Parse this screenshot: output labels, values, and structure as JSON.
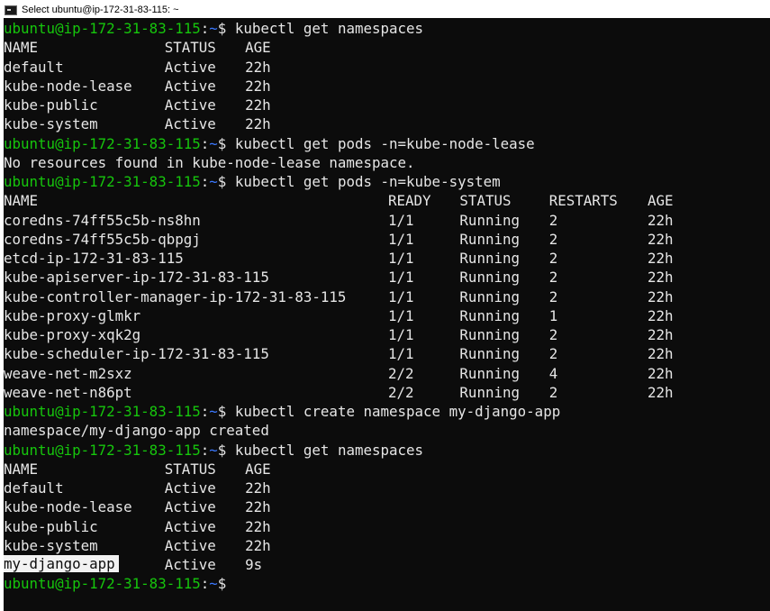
{
  "window": {
    "title": "Select ubuntu@ip-172-31-83-115: ~",
    "icon": "terminal-icon"
  },
  "colors": {
    "background": "#0c0c0c",
    "text": "#e6e6e6",
    "prompt_user": "#16c60c",
    "prompt_path": "#3b78ff",
    "selection": "#f2f2f2"
  },
  "prompt": {
    "user_host": "ubuntu@ip-172-31-83-115",
    "separator": ":",
    "path": "~",
    "symbol": "$"
  },
  "commands": [
    "kubectl get namespaces",
    "kubectl get pods -n=kube-node-lease",
    "kubectl get pods -n=kube-system",
    "kubectl create namespace my-django-app",
    "kubectl get namespaces"
  ],
  "namespaces_1": {
    "headers": [
      "NAME",
      "STATUS",
      "AGE"
    ],
    "rows": [
      [
        "default",
        "Active",
        "22h"
      ],
      [
        "kube-node-lease",
        "Active",
        "22h"
      ],
      [
        "kube-public",
        "Active",
        "22h"
      ],
      [
        "kube-system",
        "Active",
        "22h"
      ]
    ]
  },
  "no_resources_message": "No resources found in kube-node-lease namespace.",
  "pods": {
    "headers": [
      "NAME",
      "READY",
      "STATUS",
      "RESTARTS",
      "AGE"
    ],
    "rows": [
      [
        "coredns-74ff55c5b-ns8hn",
        "1/1",
        "Running",
        "2",
        "22h"
      ],
      [
        "coredns-74ff55c5b-qbpgj",
        "1/1",
        "Running",
        "2",
        "22h"
      ],
      [
        "etcd-ip-172-31-83-115",
        "1/1",
        "Running",
        "2",
        "22h"
      ],
      [
        "kube-apiserver-ip-172-31-83-115",
        "1/1",
        "Running",
        "2",
        "22h"
      ],
      [
        "kube-controller-manager-ip-172-31-83-115",
        "1/1",
        "Running",
        "2",
        "22h"
      ],
      [
        "kube-proxy-glmkr",
        "1/1",
        "Running",
        "1",
        "22h"
      ],
      [
        "kube-proxy-xqk2g",
        "1/1",
        "Running",
        "2",
        "22h"
      ],
      [
        "kube-scheduler-ip-172-31-83-115",
        "1/1",
        "Running",
        "2",
        "22h"
      ],
      [
        "weave-net-m2sxz",
        "2/2",
        "Running",
        "4",
        "22h"
      ],
      [
        "weave-net-n86pt",
        "2/2",
        "Running",
        "2",
        "22h"
      ]
    ]
  },
  "create_message": "namespace/my-django-app created",
  "namespaces_2": {
    "headers": [
      "NAME",
      "STATUS",
      "AGE"
    ],
    "rows": [
      [
        "default",
        "Active",
        "22h"
      ],
      [
        "kube-node-lease",
        "Active",
        "22h"
      ],
      [
        "kube-public",
        "Active",
        "22h"
      ],
      [
        "kube-system",
        "Active",
        "22h"
      ],
      [
        "my-django-app",
        "Active",
        "9s"
      ]
    ]
  }
}
